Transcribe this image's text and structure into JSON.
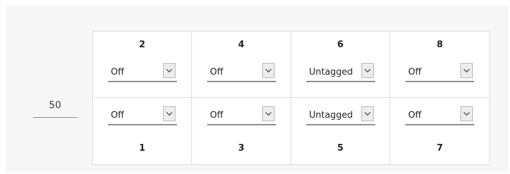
{
  "vlan_id": "50",
  "ports": [
    {
      "num": "2",
      "mode": "Off"
    },
    {
      "num": "4",
      "mode": "Off"
    },
    {
      "num": "6",
      "mode": "Untagged"
    },
    {
      "num": "8",
      "mode": "Off"
    },
    {
      "num": "1",
      "mode": "Off"
    },
    {
      "num": "3",
      "mode": "Off"
    },
    {
      "num": "5",
      "mode": "Untagged"
    },
    {
      "num": "7",
      "mode": "Off"
    }
  ],
  "icons": {
    "dropdown": "chevron-down-icon"
  }
}
